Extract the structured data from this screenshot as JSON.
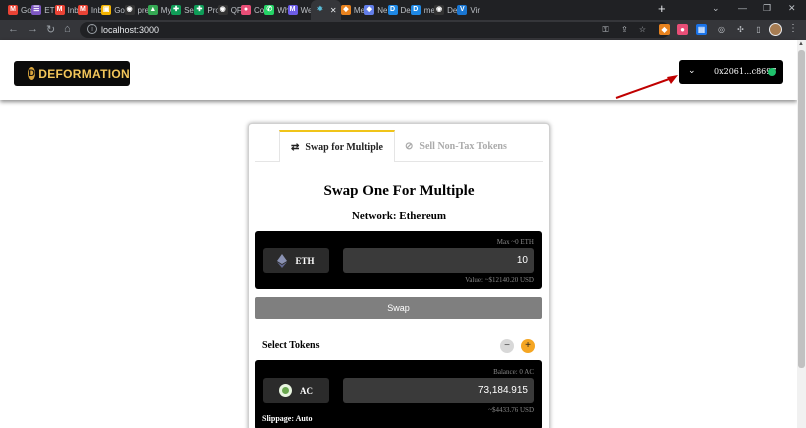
{
  "browser": {
    "tabs": [
      {
        "label": "Go",
        "icon": "gmail-icon",
        "color": "#ea4335",
        "glyph": "M"
      },
      {
        "label": "ETI",
        "icon": "doc-icon",
        "color": "#7e57c2",
        "glyph": "☰"
      },
      {
        "label": "Inb",
        "icon": "gmail-icon",
        "color": "#ea4335",
        "glyph": "M"
      },
      {
        "label": "Inb",
        "icon": "gmail-icon",
        "color": "#ea4335",
        "glyph": "M"
      },
      {
        "label": "Go",
        "icon": "note-icon",
        "color": "#f4b400",
        "glyph": "▣"
      },
      {
        "label": "pre",
        "icon": "github-icon",
        "color": "#333333",
        "glyph": "◉"
      },
      {
        "label": "My",
        "icon": "drive-icon",
        "color": "#34a853",
        "glyph": "▲"
      },
      {
        "label": "Se",
        "icon": "sheets-icon",
        "color": "#0f9d58",
        "glyph": "✚"
      },
      {
        "label": "Pro",
        "icon": "sheets-icon",
        "color": "#0f9d58",
        "glyph": "✚"
      },
      {
        "label": "QF",
        "icon": "github-icon",
        "color": "#333333",
        "glyph": "◉"
      },
      {
        "label": "Co",
        "icon": "app-icon",
        "color": "#e94e77",
        "glyph": "●"
      },
      {
        "label": "Wh",
        "icon": "whatsapp-icon",
        "color": "#25d366",
        "glyph": "✆"
      },
      {
        "label": "We",
        "icon": "web-icon",
        "color": "#6c5ce7",
        "glyph": "M"
      },
      {
        "label": "Ne",
        "icon": "eth-icon",
        "color": "#627eea",
        "glyph": "◆"
      },
      {
        "label": "De",
        "icon": "d-icon",
        "color": "#1e88e5",
        "glyph": "D"
      },
      {
        "label": "me",
        "icon": "d-icon",
        "color": "#1e88e5",
        "glyph": "D"
      },
      {
        "label": "De",
        "icon": "github-icon",
        "color": "#333333",
        "glyph": "◉"
      },
      {
        "label": "Vir",
        "icon": "v-icon",
        "color": "#1976d2",
        "glyph": "V"
      }
    ],
    "active_tab": {
      "label": "",
      "icon": "react-icon"
    },
    "metamask_tab": {
      "label": "Me"
    },
    "new_tab": "+",
    "url": "localhost:3000"
  },
  "header": {
    "logo_text": "DEFORMATION",
    "logo_mark": "D",
    "wallet_address": "0x2061...c8697",
    "wallet_status_color": "#1fc16b"
  },
  "tabs": {
    "swap_label": "Swap for Multiple",
    "sell_label": "Sell Non-Tax Tokens"
  },
  "swap": {
    "title": "Swap One For Multiple",
    "network": "Network: Ethereum",
    "from": {
      "max": "Max ~0 ETH",
      "token": "ETH",
      "amount": "10",
      "value": "Value: ~$12140.20 USD"
    },
    "swap_button": "Swap",
    "select_tokens": "Select Tokens",
    "minus": "−",
    "plus": "+",
    "to": {
      "balance": "Balance: 0 AC",
      "token": "AC",
      "amount": "73,184.915",
      "value": "~$4433.76 USD",
      "slippage": "Slippage: Auto"
    }
  },
  "colors": {
    "accent": "#f0c419",
    "plus_button": "#f5a623",
    "swap_button": "#7f7f7f"
  }
}
